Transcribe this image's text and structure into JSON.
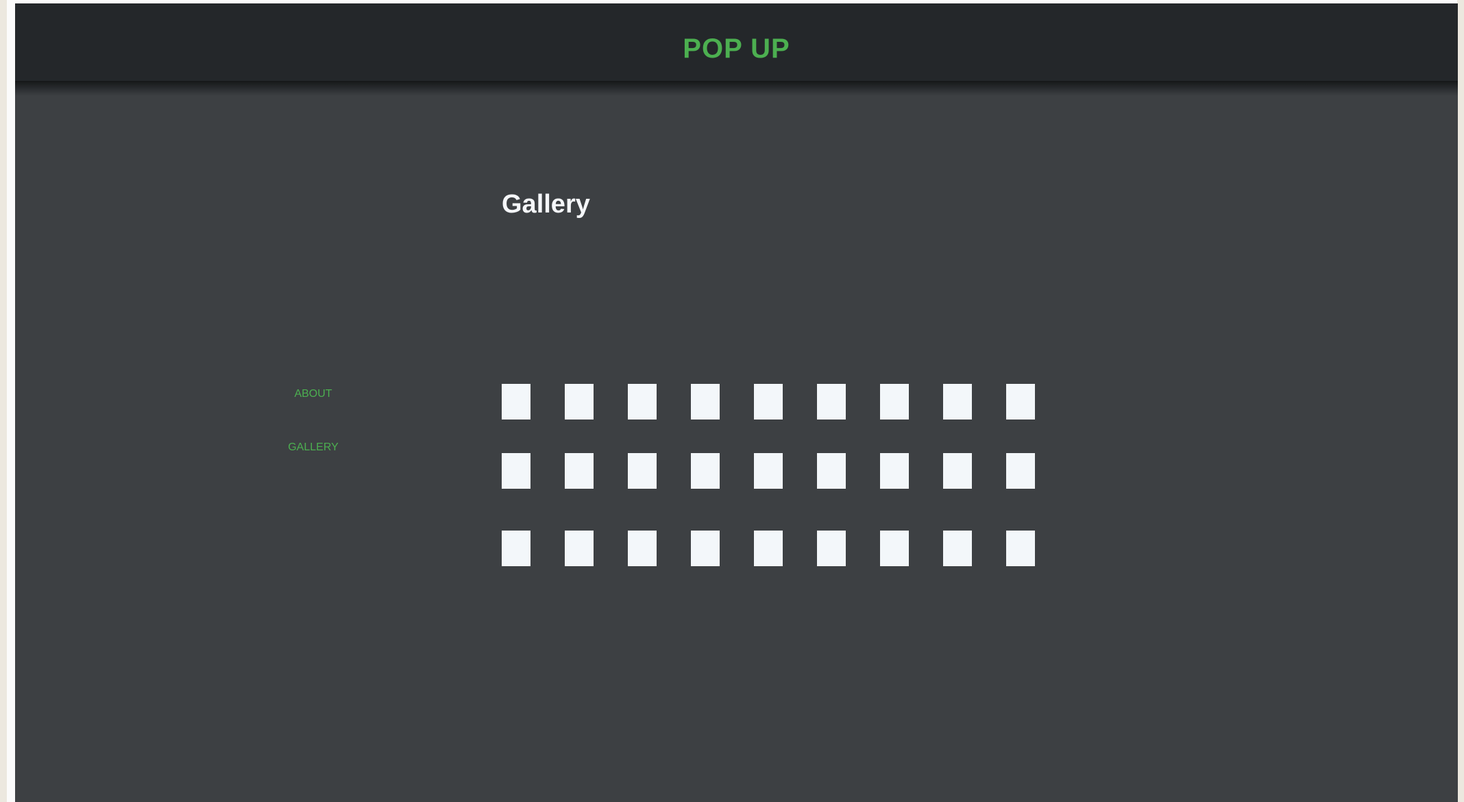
{
  "header": {
    "brand": "POP UP"
  },
  "sidebar": {
    "items": [
      {
        "label": "ABOUT"
      },
      {
        "label": "GALLERY"
      }
    ]
  },
  "main": {
    "title": "Gallery",
    "gallery": {
      "rows": 3,
      "columns": 9,
      "thumbnail_color": "#f3f7fa"
    }
  },
  "colors": {
    "accent": "#4caf50",
    "header_background": "#24272a",
    "page_background": "#3d4043",
    "title_text": "#f5f7fa"
  }
}
